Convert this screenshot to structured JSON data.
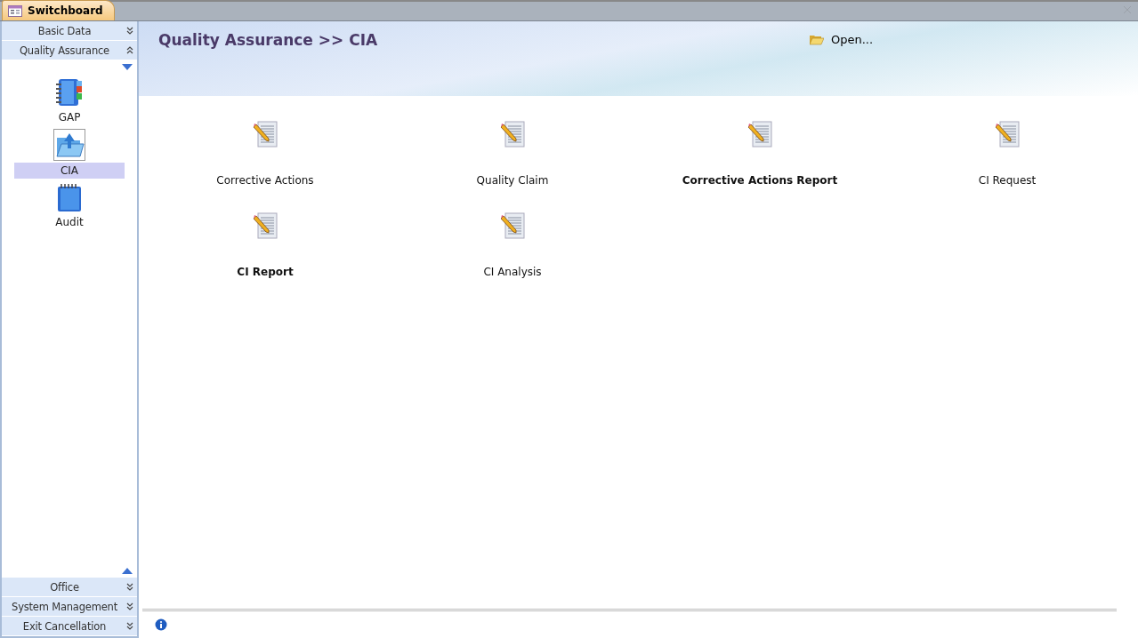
{
  "tab": {
    "title": "Switchboard"
  },
  "sidebar": {
    "groups_top": [
      {
        "label": "Basic Data",
        "expanded": false
      },
      {
        "label": "Quality Assurance",
        "expanded": true
      }
    ],
    "items": [
      {
        "label": "GAP",
        "kind": "binder",
        "selected": false
      },
      {
        "label": "CIA",
        "kind": "folder",
        "selected": true
      },
      {
        "label": "Audit",
        "kind": "notebook",
        "selected": false
      }
    ],
    "groups_bottom": [
      {
        "label": "Office",
        "expanded": false
      },
      {
        "label": "System Management",
        "expanded": false
      },
      {
        "label": "Exit Cancellation",
        "expanded": false
      }
    ]
  },
  "header": {
    "title": "Quality Assurance >> CIA",
    "open_label": "Open..."
  },
  "commands": [
    {
      "label": "Corrective Actions",
      "bold": false
    },
    {
      "label": "Quality Claim",
      "bold": false
    },
    {
      "label": "Corrective Actions Report",
      "bold": true
    },
    {
      "label": "CI Request",
      "bold": false
    },
    {
      "label": "CI Report",
      "bold": true
    },
    {
      "label": "CI Analysis",
      "bold": false
    }
  ]
}
